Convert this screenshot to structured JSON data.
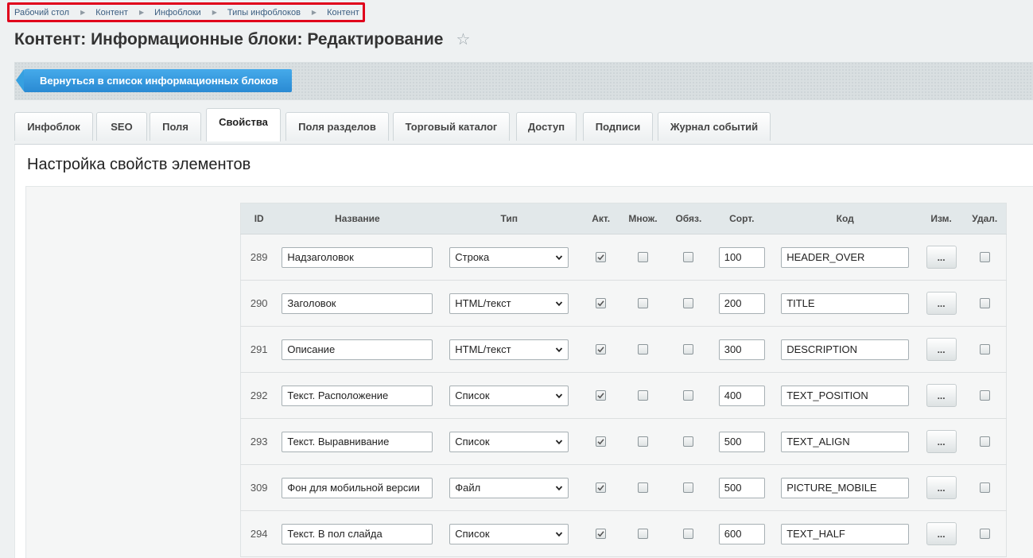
{
  "breadcrumb": [
    "Рабочий стол",
    "Контент",
    "Инфоблоки",
    "Типы инфоблоков",
    "Контент"
  ],
  "page_title": "Контент: Информационные блоки: Редактирование",
  "back_button": "Вернуться в список информационных блоков",
  "tabs": [
    {
      "label": "Инфоблок",
      "active": false
    },
    {
      "label": "SEO",
      "active": false
    },
    {
      "label": "Поля",
      "active": false
    },
    {
      "label": "Свойства",
      "active": true
    },
    {
      "label": "Поля разделов",
      "active": false
    },
    {
      "label": "Торговый каталог",
      "active": false
    },
    {
      "label": "Доступ",
      "active": false
    },
    {
      "label": "Подписи",
      "active": false
    },
    {
      "label": "Журнал событий",
      "active": false
    }
  ],
  "section_title": "Настройка свойств элементов",
  "columns": [
    "ID",
    "Название",
    "Тип",
    "Акт.",
    "Множ.",
    "Обяз.",
    "Сорт.",
    "Код",
    "Изм.",
    "Удал."
  ],
  "edit_button_label": "...",
  "rows": [
    {
      "id": "289",
      "name": "Надзаголовок",
      "type": "Строка",
      "active": true,
      "multiple": false,
      "required": false,
      "sort": "100",
      "code": "HEADER_OVER",
      "delete": false
    },
    {
      "id": "290",
      "name": "Заголовок",
      "type": "HTML/текст",
      "active": true,
      "multiple": false,
      "required": false,
      "sort": "200",
      "code": "TITLE",
      "delete": false
    },
    {
      "id": "291",
      "name": "Описание",
      "type": "HTML/текст",
      "active": true,
      "multiple": false,
      "required": false,
      "sort": "300",
      "code": "DESCRIPTION",
      "delete": false
    },
    {
      "id": "292",
      "name": "Текст. Расположение",
      "type": "Список",
      "active": true,
      "multiple": false,
      "required": false,
      "sort": "400",
      "code": "TEXT_POSITION",
      "delete": false
    },
    {
      "id": "293",
      "name": "Текст. Выравнивание",
      "type": "Список",
      "active": true,
      "multiple": false,
      "required": false,
      "sort": "500",
      "code": "TEXT_ALIGN",
      "delete": false
    },
    {
      "id": "309",
      "name": "Фон для мобильной версии",
      "type": "Файл",
      "active": true,
      "multiple": false,
      "required": false,
      "sort": "500",
      "code": "PICTURE_MOBILE",
      "delete": false
    },
    {
      "id": "294",
      "name": "Текст. В пол слайда",
      "type": "Список",
      "active": true,
      "multiple": false,
      "required": false,
      "sort": "600",
      "code": "TEXT_HALF",
      "delete": false
    }
  ],
  "colors": {
    "accent": "#2a8ad3",
    "highlight_border": "#e0001b",
    "background": "#eef1f2"
  }
}
